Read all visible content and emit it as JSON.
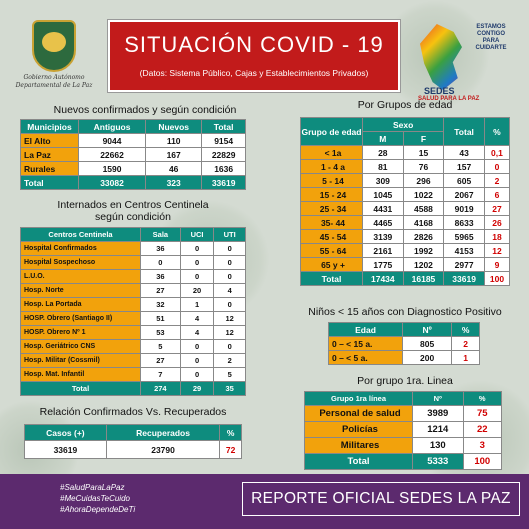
{
  "header": {
    "title": "SITUACIÓN COVID - 19",
    "subtitle": "(Datos: Sistema Público, Cajas y Establecimientos Privados)",
    "gov_text": [
      "Gobierno Autónomo",
      "Departamental de La Paz"
    ],
    "sedes_tag": [
      "ESTAMOS",
      "CONTIGO",
      "PARA",
      "CUIDARTE"
    ],
    "sedes_name": "SEDES",
    "sedes_sub": "SALUD PARA LA PAZ"
  },
  "nuevos": {
    "title": "Nuevos confirmados y según condición",
    "headers": [
      "Municipios",
      "Antiguos",
      "Nuevos",
      "Total"
    ],
    "rows": [
      [
        "El Alto",
        "9044",
        "110",
        "9154"
      ],
      [
        "La Paz",
        "22662",
        "167",
        "22829"
      ],
      [
        "Rurales",
        "1590",
        "46",
        "1636"
      ]
    ],
    "total": [
      "Total",
      "33082",
      "323",
      "33619"
    ]
  },
  "centinela": {
    "title_1": "Internados en Centros Centinela",
    "title_2": "según condición",
    "headers": [
      "Centros Centinela",
      "Sala",
      "UCI",
      "UTI"
    ],
    "rows": [
      [
        "Hospital Confirmados",
        "36",
        "0",
        "0"
      ],
      [
        "Hospital Sospechoso",
        "0",
        "0",
        "0"
      ],
      [
        "L.U.O.",
        "36",
        "0",
        "0"
      ],
      [
        "Hosp. Norte",
        "27",
        "20",
        "4"
      ],
      [
        "Hosp. La Portada",
        "32",
        "1",
        "0"
      ],
      [
        "HOSP. Obrero (Santiago II)",
        "51",
        "4",
        "12"
      ],
      [
        "HOSP. Obrero Nº 1",
        "53",
        "4",
        "12"
      ],
      [
        "Hosp. Geriátrico CNS",
        "5",
        "0",
        "0"
      ],
      [
        "Hosp. Militar (Cossmil)",
        "27",
        "0",
        "2"
      ],
      [
        "Hosp. Mat. Infantil",
        "7",
        "0",
        "5"
      ]
    ],
    "total": [
      "Total",
      "274",
      "29",
      "35"
    ]
  },
  "relacion": {
    "title": "Relación Confirmados Vs. Recuperados",
    "headers": [
      "Casos (+)",
      "Recuperados",
      "%"
    ],
    "values": [
      "33619",
      "23790",
      "72"
    ]
  },
  "edad": {
    "title": "Por Grupos de  edad",
    "header_group": "Grupo de edad",
    "header_sexo": "Sexo",
    "header_m": "M",
    "header_f": "F",
    "header_total": "Total",
    "header_pct": "%",
    "rows": [
      [
        "< 1a",
        "28",
        "15",
        "43",
        "0,1"
      ],
      [
        "1 - 4 a",
        "81",
        "76",
        "157",
        "0"
      ],
      [
        "5 - 14",
        "309",
        "296",
        "605",
        "2"
      ],
      [
        "15 - 24",
        "1045",
        "1022",
        "2067",
        "6"
      ],
      [
        "25 - 34",
        "4431",
        "4588",
        "9019",
        "27"
      ],
      [
        "35- 44",
        "4465",
        "4168",
        "8633",
        "26"
      ],
      [
        "45 - 54",
        "3139",
        "2826",
        "5965",
        "18"
      ],
      [
        "55 - 64",
        "2161",
        "1992",
        "4153",
        "12"
      ],
      [
        "65 y +",
        "1775",
        "1202",
        "2977",
        "9"
      ]
    ],
    "total": [
      "Total",
      "17434",
      "16185",
      "33619",
      "100"
    ]
  },
  "ninos": {
    "title": "Niños < 15 años con Diagnostico Positivo",
    "headers": [
      "Edad",
      "Nº",
      "%"
    ],
    "rows": [
      [
        "0 – < 15 a.",
        "805",
        "2"
      ],
      [
        "0 – < 5 a.",
        "200",
        "1"
      ]
    ]
  },
  "linea": {
    "title": "Por grupo 1ra. Linea",
    "headers": [
      "Grupo 1ra línea",
      "Nº",
      "%"
    ],
    "rows": [
      [
        "Personal de salud",
        "3989",
        "75"
      ],
      [
        "Policías",
        "1214",
        "22"
      ],
      [
        "Militares",
        "130",
        "3"
      ]
    ],
    "total": [
      "Total",
      "5333",
      "100"
    ]
  },
  "footer": {
    "hashtags": [
      "#SaludParaLaPaz",
      "#MeCuidasTeCuido",
      "#AhoraDependeDeTi"
    ],
    "report": "REPORTE OFICIAL SEDES LA PAZ"
  },
  "colors": {
    "teal": "#0e8c7e",
    "orange": "#f2a20c",
    "red": "#c21b1b",
    "purple": "#5c2a6e"
  }
}
